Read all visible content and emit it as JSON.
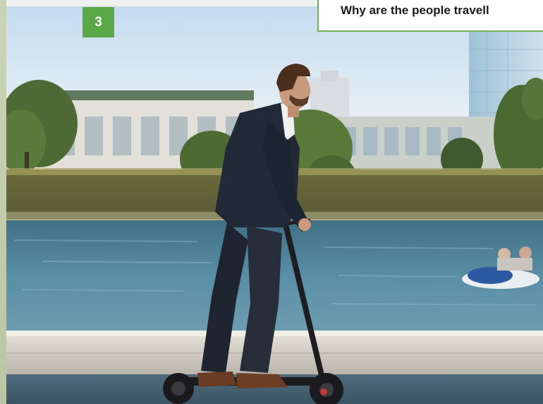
{
  "card": {
    "number": "3",
    "question": "Why are the people travell"
  },
  "photo": {
    "subject": "man-riding-electric-scooter",
    "icons": [
      "person-on-scooter",
      "river",
      "buildings",
      "trees",
      "boat"
    ]
  },
  "colors": {
    "accent": "#5aa847",
    "border": "#74b05c"
  }
}
